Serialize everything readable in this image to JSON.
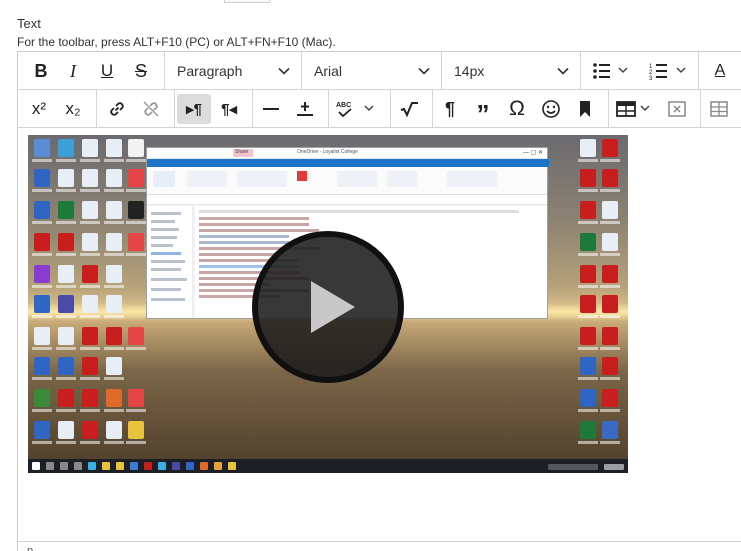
{
  "field": {
    "label": "Text",
    "help": "For the toolbar, press ALT+F10 (PC) or ALT+FN+F10 (Mac)."
  },
  "toolbar": {
    "block_format": "Paragraph",
    "font_family": "Arial",
    "font_size": "14px",
    "bold_label": "B",
    "italic_label": "I",
    "underline_label": "U",
    "strike_label": "S",
    "text_color_label": "A",
    "superscript_label": "x²",
    "subscript_label": "x₂",
    "pilcrow_label": "¶",
    "omega_label": "Ω"
  },
  "video": {
    "explorer_tab": "Share",
    "title": "OneDrive - Loyalist College"
  },
  "status": {
    "path": "p"
  },
  "colors": {
    "active_button_bg": "#dcdcdc",
    "border": "#cdcdcd",
    "explorer_ribbon": "#1e74c7"
  }
}
